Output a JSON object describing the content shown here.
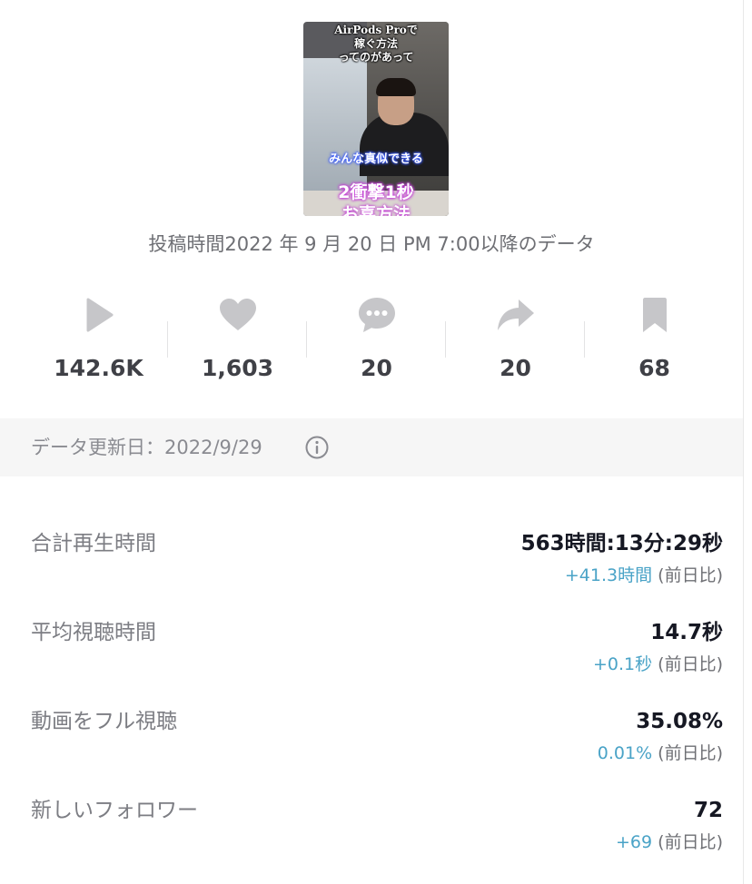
{
  "thumbnail": {
    "caption_top": [
      "AirPods Proで",
      "稼ぐ方法",
      "ってのがあって"
    ],
    "caption_middle": "みんな真似できる",
    "caption_bottom_1": "2衝撃1秒",
    "caption_bottom_2": "お喜方法"
  },
  "post_time_text": "投稿時間2022 年 9 月 20 日 PM 7:00以降のデータ",
  "stats": [
    {
      "icon": "play-icon",
      "value": "142.6K"
    },
    {
      "icon": "heart-icon",
      "value": "1,603"
    },
    {
      "icon": "comment-icon",
      "value": "20"
    },
    {
      "icon": "share-icon",
      "value": "20"
    },
    {
      "icon": "bookmark-icon",
      "value": "68"
    }
  ],
  "data_update": {
    "text": "データ更新日：2022/9/29",
    "icon": "info-icon"
  },
  "metrics": [
    {
      "label": "合計再生時間",
      "value": "563時間:13分:29秒",
      "change": "+41.3時間",
      "compare": "(前日比)"
    },
    {
      "label": "平均視聴時間",
      "value": "14.7秒",
      "change": "+0.1秒",
      "compare": "(前日比)"
    },
    {
      "label": "動画をフル視聴",
      "value": "35.08%",
      "change": "0.01%",
      "compare": "(前日比)"
    },
    {
      "label": "新しいフォロワー",
      "value": "72",
      "change": "+69",
      "compare": "(前日比)"
    }
  ],
  "colors": {
    "icon_gray": "#c6c6c9",
    "change_blue": "#4aa3c7",
    "update_bar_bg": "#f6f6f6"
  }
}
